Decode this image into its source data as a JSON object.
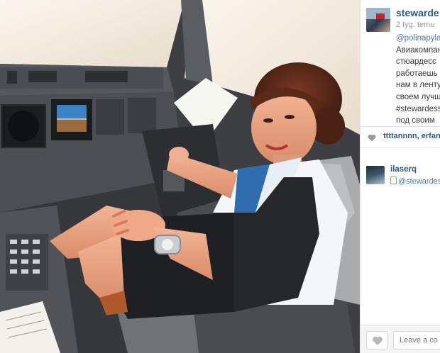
{
  "post": {
    "username": "stewarde",
    "time_ago": "2 tyg. temu",
    "caption_lines": [
      {
        "text": "@polinapylae",
        "mention": true
      },
      {
        "text": "Авиакомпан",
        "mention": false
      },
      {
        "text": "стюардесс",
        "mention": false
      },
      {
        "text": "работаешь",
        "mention": false
      },
      {
        "text": "нам в ленту",
        "mention": false
      },
      {
        "text": "своем лучш",
        "mention": false
      },
      {
        "text": "#stewardess",
        "mention": false
      },
      {
        "text": "под своим",
        "mention": false
      }
    ],
    "likers": "ttttannnn, erfan"
  },
  "comments": [
    {
      "user": "ilaserq",
      "text": "@stewardes"
    }
  ],
  "footer": {
    "comment_placeholder": "Leave a co"
  },
  "icons": [
    "heart-icon",
    "like-heart-icon"
  ],
  "colors": {
    "username": "#2b5b84",
    "mention": "#4a7aa5",
    "muted": "#9a9a9a"
  }
}
